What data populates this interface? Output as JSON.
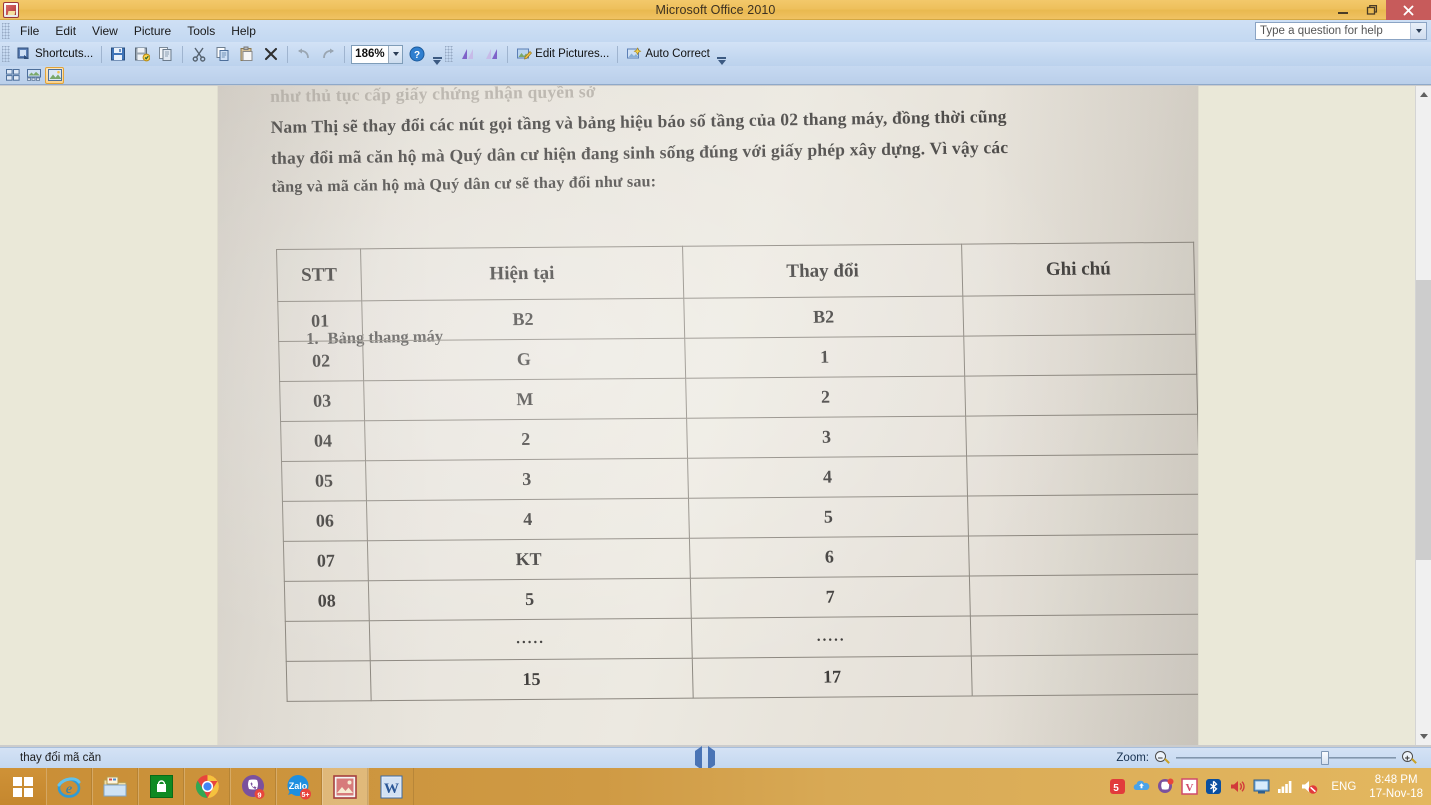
{
  "window": {
    "title": "Microsoft Office 2010",
    "app_icon": "picture-manager-icon",
    "minimize_label": "Minimize",
    "restore_label": "Restore",
    "close_label": "Close"
  },
  "menu": {
    "items": [
      {
        "label": "File"
      },
      {
        "label": "Edit"
      },
      {
        "label": "View"
      },
      {
        "label": "Picture"
      },
      {
        "label": "Tools"
      },
      {
        "label": "Help"
      }
    ],
    "help_search": {
      "placeholder": "Type a question for help",
      "value": ""
    }
  },
  "toolbar": {
    "shortcuts_label": "Shortcuts...",
    "save_label": "Save",
    "save_as_label": "Save As",
    "copy_to_label": "Copy To",
    "cut_label": "Cut",
    "copy_label": "Copy",
    "paste_label": "Paste",
    "delete_label": "Delete",
    "undo_label": "Undo",
    "redo_label": "Redo",
    "zoom_value": "186%",
    "help_label": "Microsoft Office Picture Manager Help",
    "rotate_left_label": "Rotate Left",
    "rotate_right_label": "Rotate Right",
    "edit_pictures_label": "Edit Pictures...",
    "auto_correct_label": "Auto Correct",
    "overflow_label": "Toolbar Options"
  },
  "view_buttons": {
    "thumbnail_label": "Thumbnail View",
    "filmstrip_label": "Filmstrip View",
    "single_label": "Single Picture View"
  },
  "document": {
    "paragraph": [
      "như thủ tục cấp giấy chứng nhận quyền sở",
      "Nam Thị sẽ thay đổi các nút gọi tầng và bảng hiệu báo số tầng của 02 thang máy, đồng thời cũng",
      "thay đổi mã căn hộ mà Quý dân cư hiện đang sinh sống đúng với giấy phép xây dựng. Vì vậy các",
      "tầng và mã căn hộ mà Quý dân cư sẽ thay đổi như sau:"
    ],
    "table_caption_number": "1.",
    "table_caption_text": "Bảng thang máy",
    "table": {
      "headers": [
        "STT",
        "Hiện tại",
        "Thay đổi",
        "Ghi chú"
      ],
      "rows": [
        {
          "stt": "01",
          "current": "B2",
          "changed": "B2",
          "note": ""
        },
        {
          "stt": "02",
          "current": "G",
          "changed": "1",
          "note": ""
        },
        {
          "stt": "03",
          "current": "M",
          "changed": "2",
          "note": ""
        },
        {
          "stt": "04",
          "current": "2",
          "changed": "3",
          "note": ""
        },
        {
          "stt": "05",
          "current": "3",
          "changed": "4",
          "note": ""
        },
        {
          "stt": "06",
          "current": "4",
          "changed": "5",
          "note": ""
        },
        {
          "stt": "07",
          "current": "KT",
          "changed": "6",
          "note": ""
        },
        {
          "stt": "08",
          "current": "5",
          "changed": "7",
          "note": ""
        },
        {
          "stt": "",
          "current": ".....",
          "changed": ".....",
          "note": ""
        },
        {
          "stt": "",
          "current": "15",
          "changed": "17",
          "note": ""
        }
      ]
    }
  },
  "statusbar": {
    "text": "thay đổi mã căn",
    "prev_label": "Previous",
    "next_label": "Next",
    "zoom_label": "Zoom:",
    "zoom_out_label": "Zoom Out",
    "zoom_in_label": "Zoom In"
  },
  "scrollbar": {
    "up_label": "Scroll Up",
    "down_label": "Scroll Down",
    "thumb_label": "Scroll Thumb"
  },
  "taskbar": {
    "start_label": "Start",
    "items": [
      {
        "name": "internet-explorer",
        "label": "Internet Explorer"
      },
      {
        "name": "file-explorer",
        "label": "File Explorer"
      },
      {
        "name": "windows-store",
        "label": "Store"
      },
      {
        "name": "google-chrome",
        "label": "Google Chrome"
      },
      {
        "name": "viber",
        "label": "Viber",
        "badge": "9"
      },
      {
        "name": "zalo",
        "label": "Zalo",
        "badge": "5+"
      },
      {
        "name": "picture-manager",
        "label": "Microsoft Office Picture Manager"
      },
      {
        "name": "microsoft-word",
        "label": "Microsoft Word"
      }
    ],
    "tray": [
      {
        "name": "unikey",
        "label": "UniKey"
      },
      {
        "name": "onedrive",
        "label": "OneDrive"
      },
      {
        "name": "viber-tray",
        "label": "Viber"
      },
      {
        "name": "v-app",
        "label": "V"
      },
      {
        "name": "bluetooth",
        "label": "Bluetooth"
      },
      {
        "name": "volume",
        "label": "Volume"
      },
      {
        "name": "monitor",
        "label": "Display"
      },
      {
        "name": "network",
        "label": "Network"
      },
      {
        "name": "sound-muted",
        "label": "Sound Muted"
      }
    ],
    "language": "ENG",
    "time": "8:48 PM",
    "date": "17-Nov-18"
  },
  "colors": {
    "title_bar": "#eec05c",
    "close_button": "#c75b5b",
    "toolbar": "#c5d9f1",
    "doc_background": "#eae8d8",
    "accent": "#4a74b5"
  }
}
